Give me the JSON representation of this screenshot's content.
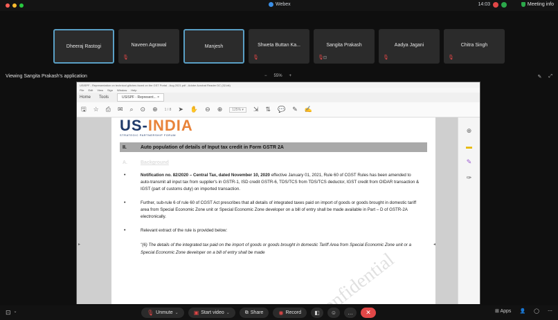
{
  "app": {
    "title": "Webex",
    "clock": "14:03",
    "meeting_info": "Meeting info"
  },
  "participants": [
    {
      "name": "Dheeraj Rastogi",
      "active": true,
      "muted": false,
      "extra": ""
    },
    {
      "name": "Naveen Agrawal",
      "active": false,
      "muted": true,
      "extra": ""
    },
    {
      "name": "Manjesh",
      "active": true,
      "muted": false,
      "extra": ""
    },
    {
      "name": "Shweta Buttan Ka...",
      "active": false,
      "muted": true,
      "extra": ""
    },
    {
      "name": "Sangita Prakash",
      "active": false,
      "muted": true,
      "extra": "⊡"
    },
    {
      "name": "Aadya Jagani",
      "active": false,
      "muted": true,
      "extra": ""
    },
    {
      "name": "Chitra Singh",
      "active": false,
      "muted": true,
      "extra": ""
    }
  ],
  "viewbar": {
    "label": "Viewing Sangita Prakash's application",
    "zoom": "55%",
    "minus": "−",
    "plus": "+"
  },
  "viewer": {
    "window_title": "USISPF - Representation on technical glitches faced on the GST Portal - Aug 2021.pdf - Adobe Acrobat Reader DC (32-bit)",
    "menu": [
      "File",
      "Edit",
      "View",
      "Sign",
      "Window",
      "Help"
    ],
    "tabs": {
      "home": "Home",
      "tools": "Tools",
      "doc": "USISPF - Represent... ×"
    },
    "page_indicator": "1 / 8",
    "zoom_value": "125% ▾"
  },
  "document": {
    "logo_us": "US-",
    "logo_india": "INDIA",
    "logo_sub": "STRATEGIC PARTNERSHIP FORUM",
    "section_num": "II.",
    "section_title": "Auto population of details of Input tax credit in Form GSTR 2A",
    "sub_letter": "A.",
    "sub_title": "Background",
    "bullet1_bold": "Notification no. 82/2020 – Central Tax, dated November 10, 2020",
    "bullet1_rest": " effective January 01, 2021, Rule 60 of CGST Rules has been amended to auto-transmit all input tax from supplier's in GSTR-1, ISD credit GSTR-6, TDS/TCS from TDS/TCS deductor, IGST credit from OIDAR transaction & IGST (part of customs duty) on imported transaction.",
    "bullet2": "Further, sub-rule 6 of rule 60 of CGST Act prescribes that all details of integrated taxes paid on import of goods or goods brought in domestic tariff area from Special Economic Zone unit or Special Economic Zone developer on a bill of entry shall be made available in Part – D of GSTR-2A electronically.",
    "bullet3": "Relevant extract of the rule is provided below:",
    "quote": "\"(6) The details of the integrated tax paid on the import of goods or goods brought in domestic Tariff Area from Special Economic Zone unit or a Special Economic Zone developer on a bill of entry shall be made",
    "watermark": "Confidential"
  },
  "controls": {
    "unmute": "Unmute",
    "start_video": "Start video",
    "share": "Share",
    "record": "Record",
    "apps": "Apps"
  },
  "colors": {
    "accent": "#5aa0c6",
    "end_call": "#e24747",
    "bg": "#0f0f0f"
  }
}
